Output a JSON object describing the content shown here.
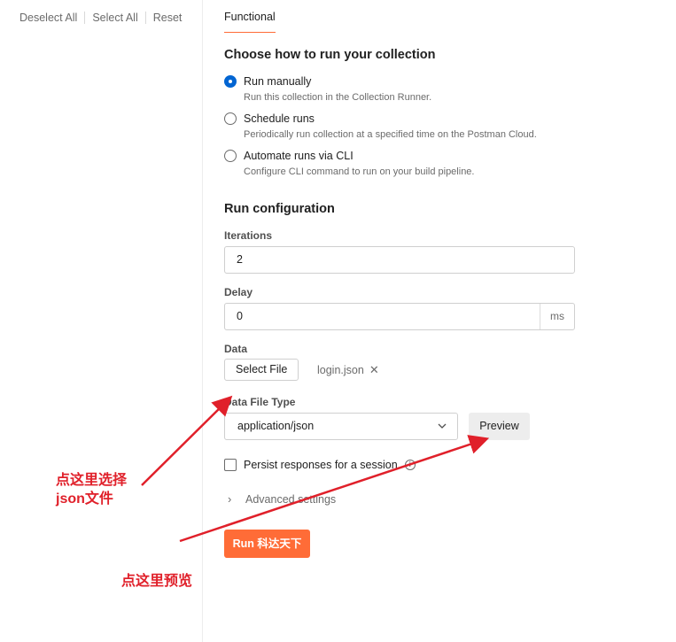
{
  "sidebar": {
    "deselect_all": "Deselect All",
    "select_all": "Select All",
    "reset": "Reset"
  },
  "tabs": {
    "functional": "Functional"
  },
  "run_mode": {
    "heading": "Choose how to run your collection",
    "options": [
      {
        "label": "Run manually",
        "desc": "Run this collection in the Collection Runner.",
        "checked": true
      },
      {
        "label": "Schedule runs",
        "desc": "Periodically run collection at a specified time on the Postman Cloud.",
        "checked": false
      },
      {
        "label": "Automate runs via CLI",
        "desc": "Configure CLI command to run on your build pipeline.",
        "checked": false
      }
    ]
  },
  "config": {
    "heading": "Run configuration",
    "iterations_label": "Iterations",
    "iterations_value": "2",
    "delay_label": "Delay",
    "delay_value": "0",
    "delay_unit": "ms",
    "data_label": "Data",
    "select_file": "Select File",
    "file_name": "login.json",
    "data_file_type_label": "Data File Type",
    "data_file_type_value": "application/json",
    "preview": "Preview",
    "persist_label": "Persist responses for a session",
    "persist_checked": false,
    "advanced": "Advanced settings",
    "run_button": "Run 科达天下"
  },
  "annotations": {
    "select_json_line1": "点这里选择",
    "select_json_line2": "json文件",
    "preview_note": "点这里预览",
    "color": "#e0202a"
  },
  "colors": {
    "accent": "#ff6c37",
    "radio_checked": "#0265d2"
  }
}
